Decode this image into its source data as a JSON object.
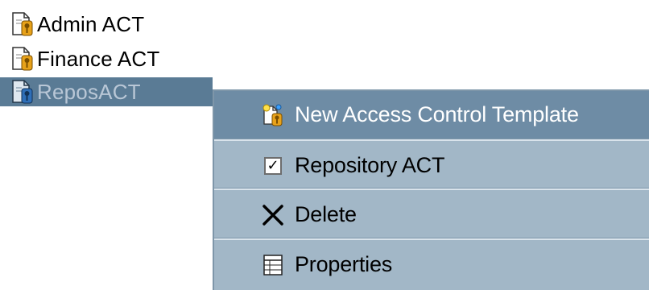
{
  "tree": {
    "items": [
      {
        "label": "Admin ACT",
        "icon": "document-key-icon",
        "selected": false
      },
      {
        "label": "Finance ACT",
        "icon": "document-key-icon",
        "selected": false
      },
      {
        "label": "ReposACT",
        "icon": "document-key-blue-icon",
        "selected": true
      }
    ]
  },
  "context_menu": {
    "items": [
      {
        "label": "New Access Control Template",
        "icon": "new-template-icon",
        "highlighted": true
      },
      {
        "label": "Repository ACT",
        "icon": "checkbox-icon",
        "checked": true
      },
      {
        "label": "Delete",
        "icon": "delete-x-icon"
      },
      {
        "label": "Properties",
        "icon": "properties-icon"
      }
    ],
    "check_mark": "✓",
    "delete_glyph": "✕"
  },
  "colors": {
    "selection_bg": "#5a7b95",
    "menu_bg": "#a2b7c7",
    "menu_highlight": "#6e8ca5",
    "separator": "#d9e3eb"
  }
}
